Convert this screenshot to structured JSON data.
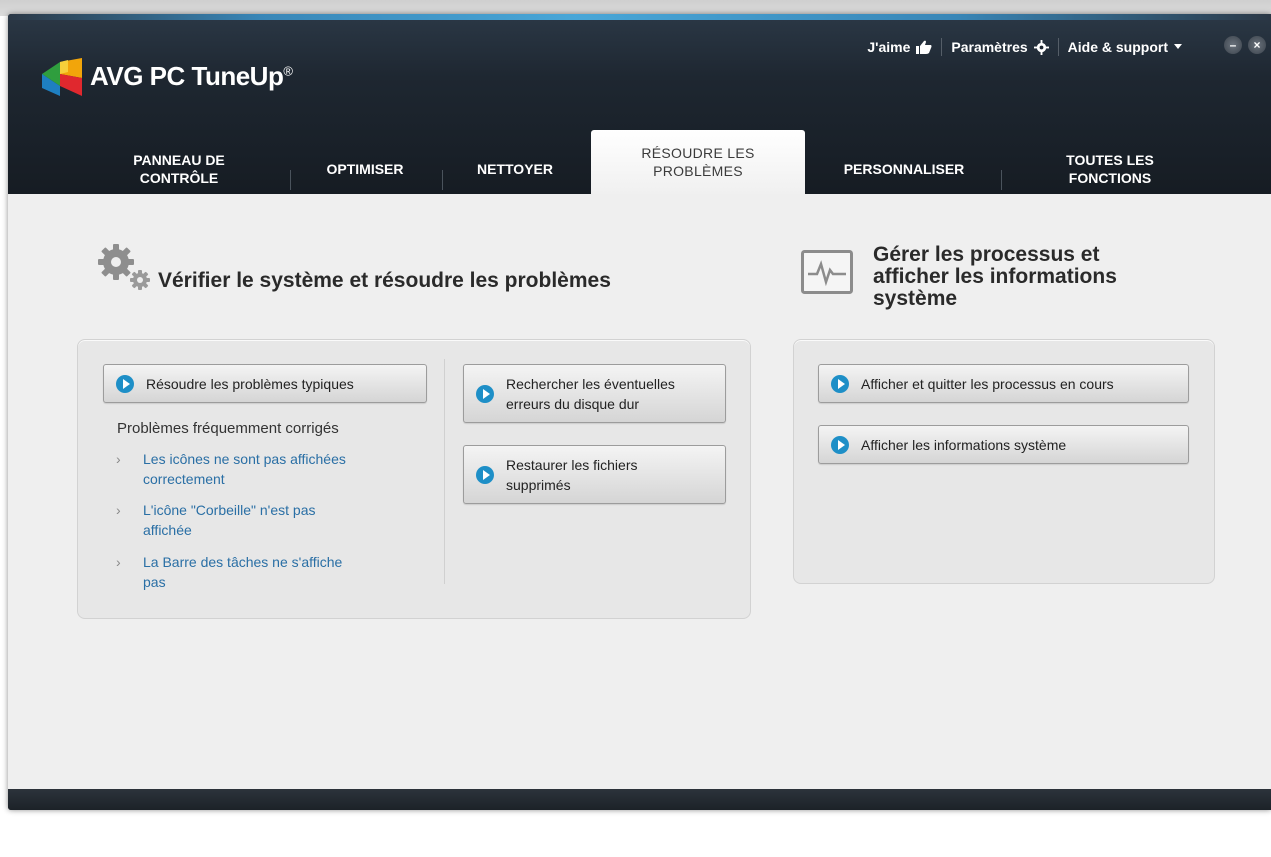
{
  "app": {
    "brand_prefix": "AVG",
    "brand_name": "PC TuneUp",
    "brand_reg": "®"
  },
  "topmenu": {
    "like_label": "J'aime",
    "settings_label": "Paramètres",
    "help_label": "Aide & support",
    "minimize_glyph": "–",
    "close_glyph": "×"
  },
  "tabs": [
    {
      "line1": "PANNEAU DE",
      "line2": "CONTRÔLE"
    },
    {
      "line1": "OPTIMISER",
      "line2": ""
    },
    {
      "line1": "NETTOYER",
      "line2": ""
    },
    {
      "line1": "RÉSOUDRE LES",
      "line2": "PROBLÈMES"
    },
    {
      "line1": "PERSONNALISER",
      "line2": ""
    },
    {
      "line1": "TOUTES LES",
      "line2": "FONCTIONS"
    }
  ],
  "left_section": {
    "title": "Vérifier le système et résoudre les problèmes",
    "main_button": "Résoudre les problèmes typiques",
    "frequent_title": "Problèmes fréquemment corrigés",
    "links": [
      {
        "line1": "Les icônes ne sont pas affichées",
        "line2": "correctement"
      },
      {
        "line1": "L'icône \"Corbeille\" n'est pas",
        "line2": "affichée"
      },
      {
        "line1": "La Barre des tâches ne s'affiche",
        "line2": "pas"
      }
    ],
    "disk_button": {
      "line1": "Rechercher les éventuelles",
      "line2": "erreurs du disque dur"
    },
    "restore_button": {
      "line1": "Restaurer les fichiers",
      "line2": "supprimés"
    }
  },
  "right_section": {
    "title_line1": "Gérer les processus et",
    "title_line2": "afficher les informations",
    "title_line3": "système",
    "processes_button": "Afficher et quitter les processus en cours",
    "sysinfo_button": "Afficher les informations système"
  },
  "colors": {
    "accent_blue": "#1e8fc7",
    "link_blue": "#2a6fa5",
    "header_dark": "#1e2731"
  },
  "icons": {
    "like": "thumbs-up-icon",
    "settings": "gear-icon",
    "help_dropdown": "caret-down-icon",
    "section_left": "gears-icon",
    "section_right": "monitor-pulse-icon",
    "button_play": "play-circle-icon",
    "link_chevron": "chevron-right-icon"
  }
}
